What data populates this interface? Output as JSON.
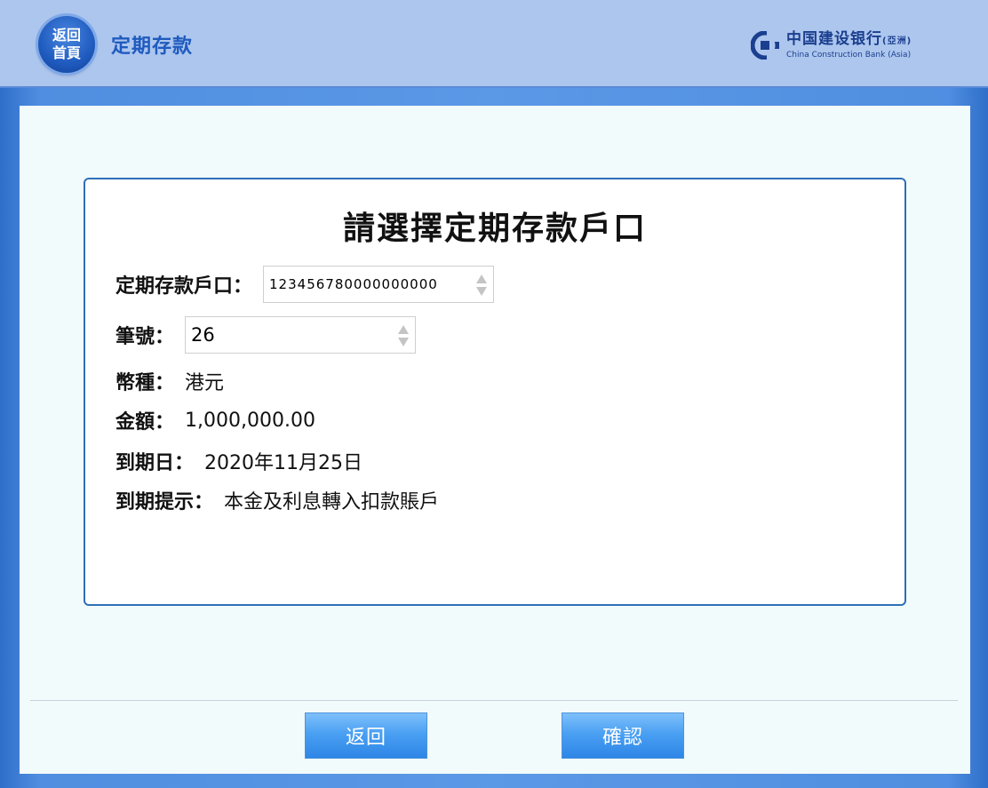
{
  "header": {
    "home_line1": "返回",
    "home_line2": "首頁",
    "title": "定期存款",
    "logo": {
      "cn": "中国建设银行",
      "cn_suffix": "(亞洲)",
      "en": "China Construction Bank (Asia)"
    }
  },
  "card": {
    "title": "請選擇定期存款戶口",
    "account": {
      "label": "定期存款戶口：",
      "value": "123456780000000000"
    },
    "batch": {
      "label": "筆號：",
      "value": "26"
    },
    "currency": {
      "label": "幣種：",
      "value": "港元"
    },
    "amount": {
      "label": "金額：",
      "value": "1,000,000.00"
    },
    "maturity_date": {
      "label": "到期日：",
      "value": "2020年11月25日"
    },
    "maturity_instruction": {
      "label": "到期提示：",
      "value": "本金及利息轉入扣款賬戶"
    }
  },
  "footer": {
    "back_label": "返回",
    "confirm_label": "確認"
  },
  "colors": {
    "accent": "#1f5bbf",
    "button": "#4aa0f2",
    "card_border": "#2e6fb8"
  }
}
